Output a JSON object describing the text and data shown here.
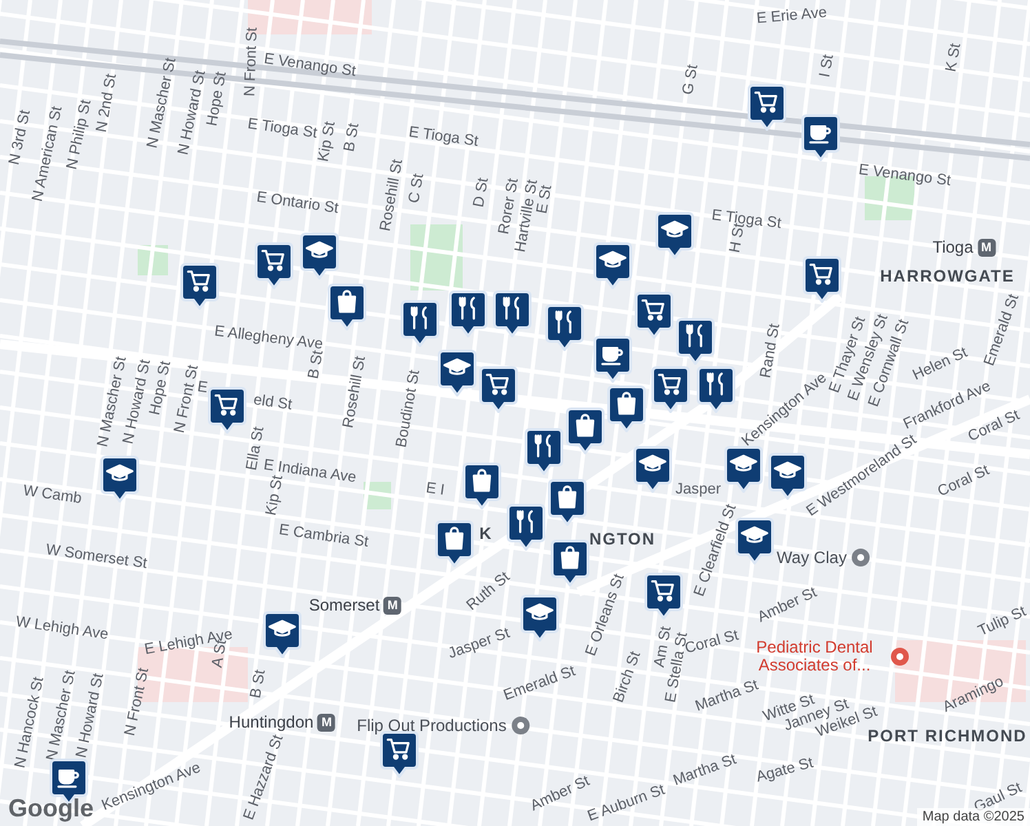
{
  "labels": [
    {
      "text": "E Erie Ave",
      "kind": "street"
    },
    {
      "text": "N Front St",
      "kind": "street"
    },
    {
      "text": "E Venango St",
      "kind": "street"
    },
    {
      "text": "N 2nd St",
      "kind": "street"
    },
    {
      "text": "N Mascher St",
      "kind": "street"
    },
    {
      "text": "N Howard St",
      "kind": "street"
    },
    {
      "text": "Hope St",
      "kind": "street"
    },
    {
      "text": "N 3rd St",
      "kind": "street"
    },
    {
      "text": "N American St",
      "kind": "street"
    },
    {
      "text": "N Philip St",
      "kind": "street"
    },
    {
      "text": "E Tioga St",
      "kind": "street"
    },
    {
      "text": "Kip St",
      "kind": "street"
    },
    {
      "text": "B St",
      "kind": "street"
    },
    {
      "text": "E Tioga St",
      "kind": "street"
    },
    {
      "text": "E Ontario St",
      "kind": "street"
    },
    {
      "text": "Rosehill St",
      "kind": "street"
    },
    {
      "text": "C St",
      "kind": "street"
    },
    {
      "text": "D St",
      "kind": "street"
    },
    {
      "text": "Rorer St",
      "kind": "street"
    },
    {
      "text": "Hartville St",
      "kind": "street"
    },
    {
      "text": "E St",
      "kind": "street"
    },
    {
      "text": "G St",
      "kind": "street"
    },
    {
      "text": "I St",
      "kind": "street"
    },
    {
      "text": "K St",
      "kind": "street"
    },
    {
      "text": "E Venango St",
      "kind": "street"
    },
    {
      "text": "E Tioga St",
      "kind": "street"
    },
    {
      "text": "H St",
      "kind": "street"
    },
    {
      "text": "Tioga",
      "kind": "transit",
      "badge": "M"
    },
    {
      "text": "HARROWGATE",
      "kind": "area"
    },
    {
      "text": "E Allegheny Ave",
      "kind": "street"
    },
    {
      "text": "Rand St",
      "kind": "street"
    },
    {
      "text": "Kensington Ave",
      "kind": "street"
    },
    {
      "text": "E Thayer St",
      "kind": "street"
    },
    {
      "text": "E Wensley St",
      "kind": "street"
    },
    {
      "text": "E Cornwall St",
      "kind": "street"
    },
    {
      "text": "E Westmoreland St",
      "kind": "street"
    },
    {
      "text": "Helen St",
      "kind": "street"
    },
    {
      "text": "Emerald St",
      "kind": "street"
    },
    {
      "text": "N Mascher St",
      "kind": "street"
    },
    {
      "text": "N Howard St",
      "kind": "street"
    },
    {
      "text": "Hope St",
      "kind": "street"
    },
    {
      "text": "N Front St",
      "kind": "street"
    },
    {
      "text": "E",
      "kind": "street"
    },
    {
      "text": "eld St",
      "kind": "street"
    },
    {
      "text": "Rosehill St",
      "kind": "street"
    },
    {
      "text": "Boudinot St",
      "kind": "street"
    },
    {
      "text": "B St",
      "kind": "street"
    },
    {
      "text": "Ella St",
      "kind": "street"
    },
    {
      "text": "E Indiana Ave",
      "kind": "street"
    },
    {
      "text": "Kip St",
      "kind": "street"
    },
    {
      "text": "W Camb",
      "kind": "street"
    },
    {
      "text": "E Cambria St",
      "kind": "street"
    },
    {
      "text": "E I",
      "kind": "street"
    },
    {
      "text": "K",
      "kind": "area"
    },
    {
      "text": "NGTON",
      "kind": "area"
    },
    {
      "text": "W Somerset St",
      "kind": "street"
    },
    {
      "text": "Somerset",
      "kind": "transit",
      "badge": "M"
    },
    {
      "text": "Ruth St",
      "kind": "street"
    },
    {
      "text": "E Orleans St",
      "kind": "street"
    },
    {
      "text": "Jasper St",
      "kind": "street"
    },
    {
      "text": "Birch St",
      "kind": "street"
    },
    {
      "text": "Emerald St",
      "kind": "street"
    },
    {
      "text": "W Lehigh Ave",
      "kind": "street"
    },
    {
      "text": "E Lehigh Ave",
      "kind": "street"
    },
    {
      "text": "N Hancock St",
      "kind": "street"
    },
    {
      "text": "N Mascher St",
      "kind": "street"
    },
    {
      "text": "N Howard St",
      "kind": "street"
    },
    {
      "text": "N Front St",
      "kind": "street"
    },
    {
      "text": "A St",
      "kind": "street"
    },
    {
      "text": "B St",
      "kind": "street"
    },
    {
      "text": "Huntingdon",
      "kind": "transit",
      "badge": "M"
    },
    {
      "text": "Flip Out Productions",
      "kind": "poi"
    },
    {
      "text": "Kensington Ave",
      "kind": "street"
    },
    {
      "text": "E Hazzard St",
      "kind": "street"
    },
    {
      "text": "Jasper",
      "kind": "street"
    },
    {
      "text": "E Clearfield St",
      "kind": "street"
    },
    {
      "text": "Frankford Ave",
      "kind": "street"
    },
    {
      "text": "Coral St",
      "kind": "street"
    },
    {
      "text": "Coral St",
      "kind": "street"
    },
    {
      "text": "Coral St",
      "kind": "street"
    },
    {
      "text": "Way Clay",
      "kind": "poi"
    },
    {
      "text": "Amber St",
      "kind": "street"
    },
    {
      "text": "Amber St",
      "kind": "street"
    },
    {
      "text": "Tulip St",
      "kind": "street"
    },
    {
      "text": "Martha St",
      "kind": "street"
    },
    {
      "text": "Martha St",
      "kind": "street"
    },
    {
      "text": "Am St",
      "kind": "street"
    },
    {
      "text": "E Stella St",
      "kind": "street"
    },
    {
      "text": "Witte St",
      "kind": "street"
    },
    {
      "text": "Janney St",
      "kind": "street"
    },
    {
      "text": "Weikel St",
      "kind": "street"
    },
    {
      "text": "Pediatric Dental Associates of...",
      "kind": "medical"
    },
    {
      "text": "PORT RICHMOND",
      "kind": "area"
    },
    {
      "text": "Aramingo",
      "kind": "street"
    },
    {
      "text": "Agate St",
      "kind": "street"
    },
    {
      "text": "E Auburn St",
      "kind": "street"
    },
    {
      "text": "Gaul St",
      "kind": "street"
    }
  ],
  "pins": [
    {
      "kind": "grocery"
    },
    {
      "kind": "cafe"
    },
    {
      "kind": "school"
    },
    {
      "kind": "school"
    },
    {
      "kind": "grocery"
    },
    {
      "kind": "grocery"
    },
    {
      "kind": "grocery"
    },
    {
      "kind": "school"
    },
    {
      "kind": "grocery"
    },
    {
      "kind": "shopping"
    },
    {
      "kind": "restaurant"
    },
    {
      "kind": "restaurant"
    },
    {
      "kind": "restaurant"
    },
    {
      "kind": "restaurant"
    },
    {
      "kind": "school"
    },
    {
      "kind": "grocery"
    },
    {
      "kind": "cafe"
    },
    {
      "kind": "restaurant"
    },
    {
      "kind": "restaurant"
    },
    {
      "kind": "grocery"
    },
    {
      "kind": "shopping"
    },
    {
      "kind": "shopping"
    },
    {
      "kind": "grocery"
    },
    {
      "kind": "school"
    },
    {
      "kind": "restaurant"
    },
    {
      "kind": "shopping"
    },
    {
      "kind": "school"
    },
    {
      "kind": "school"
    },
    {
      "kind": "school"
    },
    {
      "kind": "shopping"
    },
    {
      "kind": "restaurant"
    },
    {
      "kind": "shopping"
    },
    {
      "kind": "shopping"
    },
    {
      "kind": "school"
    },
    {
      "kind": "grocery"
    },
    {
      "kind": "school"
    },
    {
      "kind": "school"
    },
    {
      "kind": "grocery"
    },
    {
      "kind": "cafe"
    }
  ],
  "logo": "Google",
  "attribution": "Map data ©2025"
}
